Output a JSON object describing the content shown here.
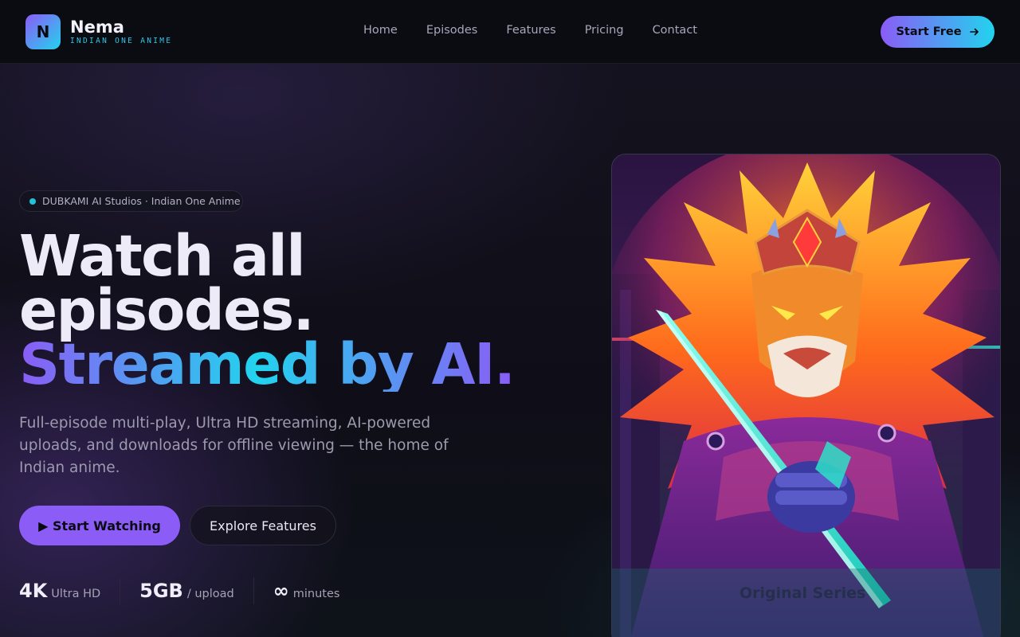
{
  "brand": {
    "logo_letter": "N",
    "name": "Nema",
    "tagline": "INDIAN ONE ANIME"
  },
  "nav": {
    "links": [
      "Home",
      "Episodes",
      "Features",
      "Pricing",
      "Contact"
    ],
    "cta_label": "Start Free",
    "cta_icon": "arrow-right-icon"
  },
  "hero": {
    "badge": "DUBKAMI AI Studios · Indian One Anime",
    "headline_line1": "Watch all",
    "headline_line2": "episodes.",
    "headline_line3": "Streamed by AI.",
    "subtext": "Full-episode multi-play, Ultra HD streaming, AI-powered uploads, and downloads for offline viewing — the home of Indian anime.",
    "primary_button": "▶ Start Watching",
    "secondary_button": "Explore Features"
  },
  "stats": [
    {
      "value": "4K",
      "label": "Ultra HD"
    },
    {
      "value": "5GB",
      "label": "/ upload"
    },
    {
      "value": "∞",
      "label": "minutes"
    }
  ],
  "art": {
    "caption": "Original Series"
  },
  "colors": {
    "accent_purple": "#8b5cf6",
    "accent_cyan": "#22d3ee",
    "background": "#0d0d16"
  }
}
